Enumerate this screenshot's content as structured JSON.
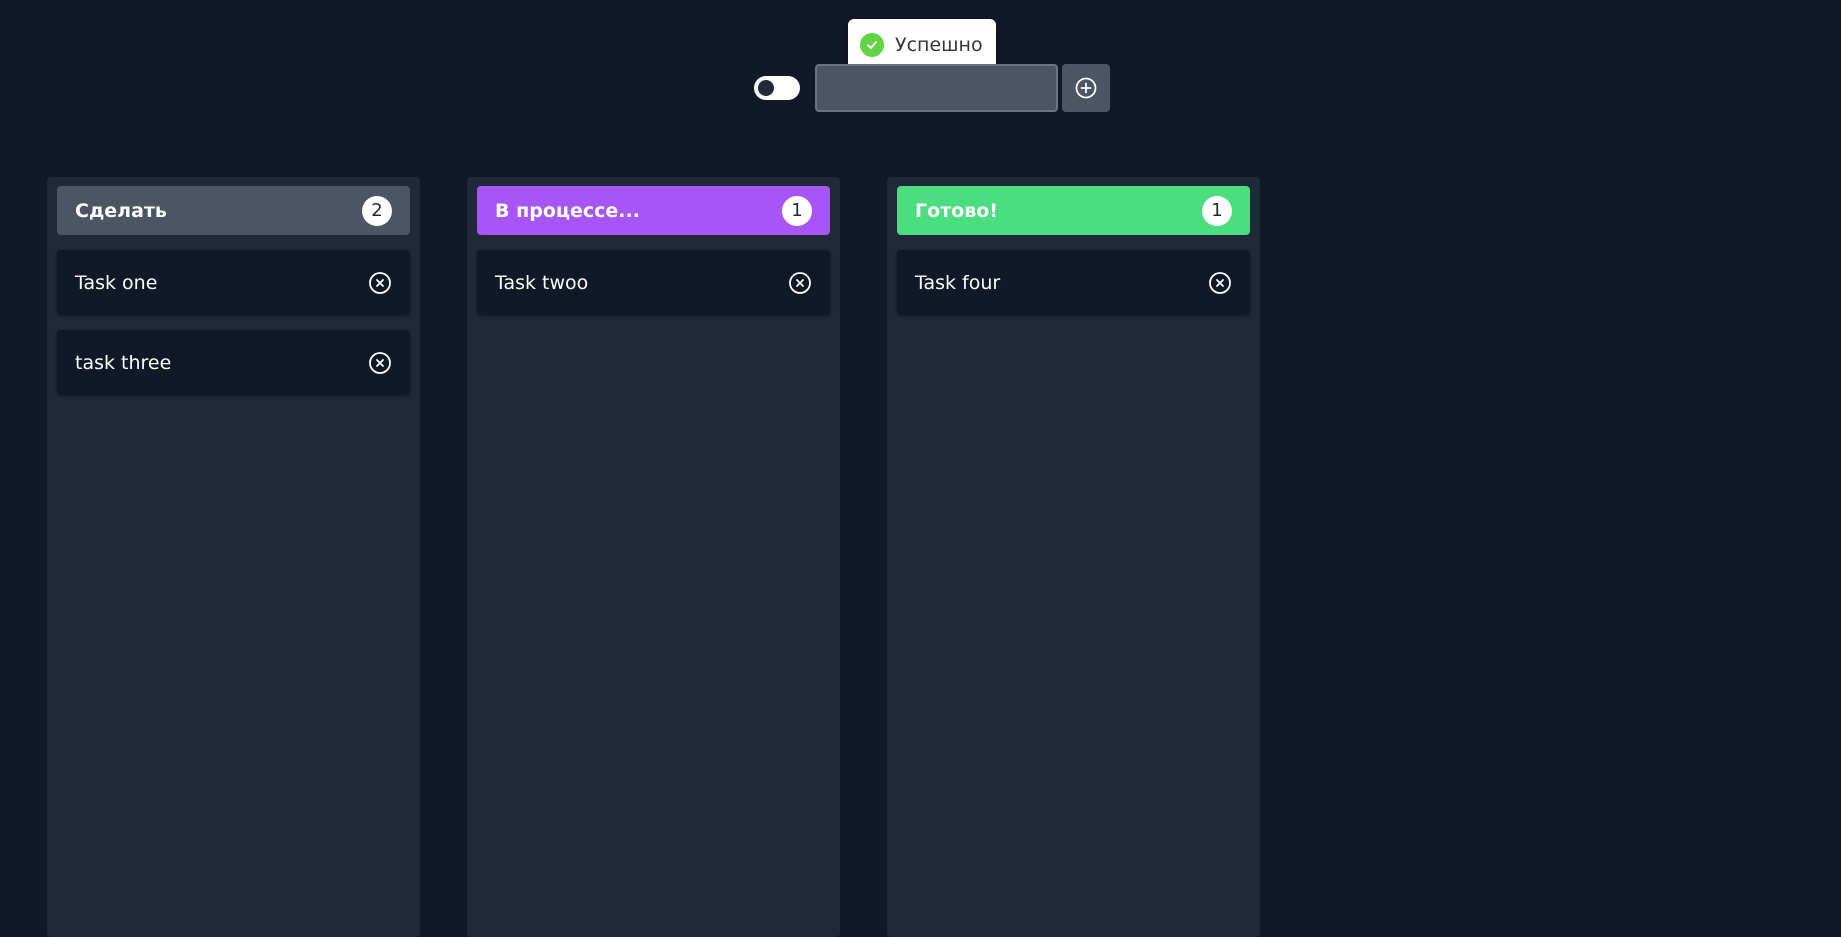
{
  "toast": {
    "text": "Успешно",
    "icon": "check-circle-icon",
    "color": "#61d345"
  },
  "toolbar": {
    "theme_toggle_icon": "toggle-switch-icon",
    "task_input_value": "",
    "task_input_placeholder": "",
    "add_icon": "plus-circle-icon"
  },
  "columns": [
    {
      "title": "Сделать",
      "count": "2",
      "color": "#4b5563",
      "tasks": [
        {
          "title": "Task one"
        },
        {
          "title": "task three"
        }
      ]
    },
    {
      "title": "В процессе...",
      "count": "1",
      "color": "#a855f7",
      "tasks": [
        {
          "title": "Task twoo"
        }
      ]
    },
    {
      "title": "Готово!",
      "count": "1",
      "color": "#4ade80",
      "tasks": [
        {
          "title": "Task four"
        }
      ]
    }
  ],
  "task_remove_icon": "x-circle-icon"
}
